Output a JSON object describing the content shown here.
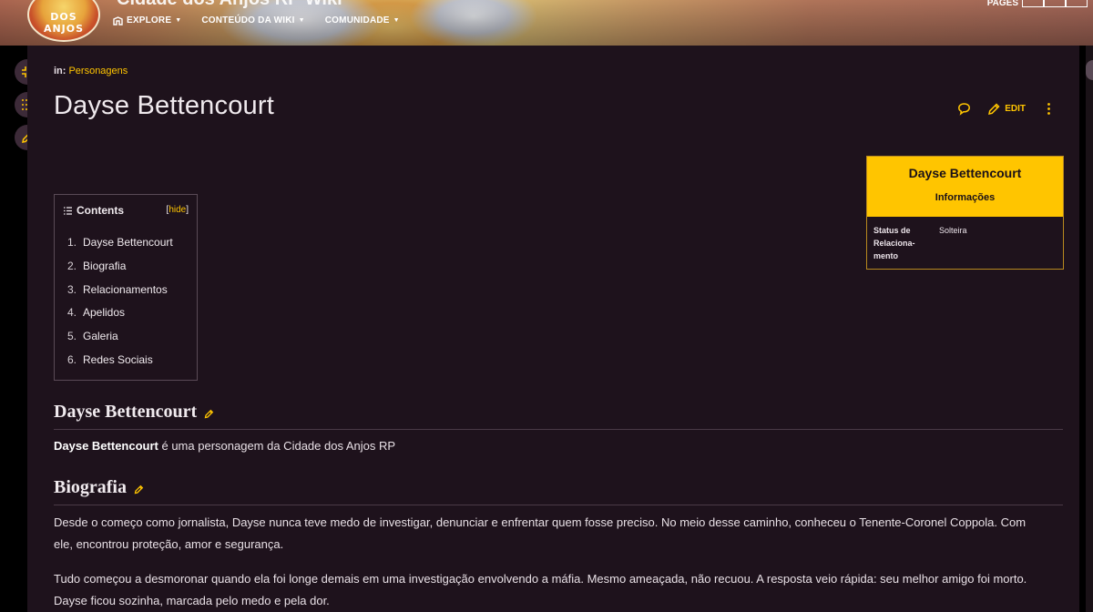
{
  "banner": {
    "logo_text": "DOS ANJOS",
    "site_title": "Cidade dos Anjos RP Wiki",
    "nav": [
      {
        "label": "EXPLORE",
        "icon": "explore-icon"
      },
      {
        "label": "CONTEÚDO DA WIKI"
      },
      {
        "label": "COMUNIDADE"
      }
    ],
    "pages_label": "PAGES"
  },
  "breadcrumb": {
    "prefix": "in:",
    "category": "Personagens"
  },
  "page": {
    "title": "Dayse Bettencourt"
  },
  "actions": {
    "edit_label": "EDIT"
  },
  "infobox": {
    "title": "Dayse Bettencourt",
    "section": "Informações",
    "rows": [
      {
        "label": [
          "Status de",
          "Relaciona-",
          "mento"
        ],
        "value": "Solteira"
      }
    ]
  },
  "toc": {
    "title": "Contents",
    "hide_label": "hide",
    "items": [
      {
        "num": "1.",
        "label": "Dayse Bettencourt"
      },
      {
        "num": "2.",
        "label": "Biografia"
      },
      {
        "num": "3.",
        "label": "Relacionamentos"
      },
      {
        "num": "4.",
        "label": "Apelidos"
      },
      {
        "num": "5.",
        "label": "Galeria"
      },
      {
        "num": "6.",
        "label": "Redes Sociais"
      }
    ]
  },
  "sections": {
    "intro": {
      "heading": "Dayse Bettencourt",
      "bold": "Dayse Bettencourt",
      "text": " é uma personagem da Cidade dos Anjos RP"
    },
    "bio": {
      "heading": "Biografia",
      "p1_line1": "Desde o começo como jornalista, Dayse nunca teve medo de investigar, denunciar e enfrentar quem fosse preciso. No meio desse caminho, conheceu o Tenente-Coronel Coppola. Com",
      "p1_line2": "ele, encontrou proteção, amor e segurança.",
      "p2_line1": "Tudo começou a desmoronar quando ela foi longe demais em uma investigação envolvendo a máfia. Mesmo ameaçada, não recuou. A resposta veio rápida: seu melhor amigo foi morto.",
      "p2_line2": "Dayse ficou sozinha, marcada pelo medo e pela dor."
    }
  },
  "colors": {
    "accent": "#ffc500",
    "page_bg": "#1e121c",
    "text": "#e8e0e6"
  }
}
